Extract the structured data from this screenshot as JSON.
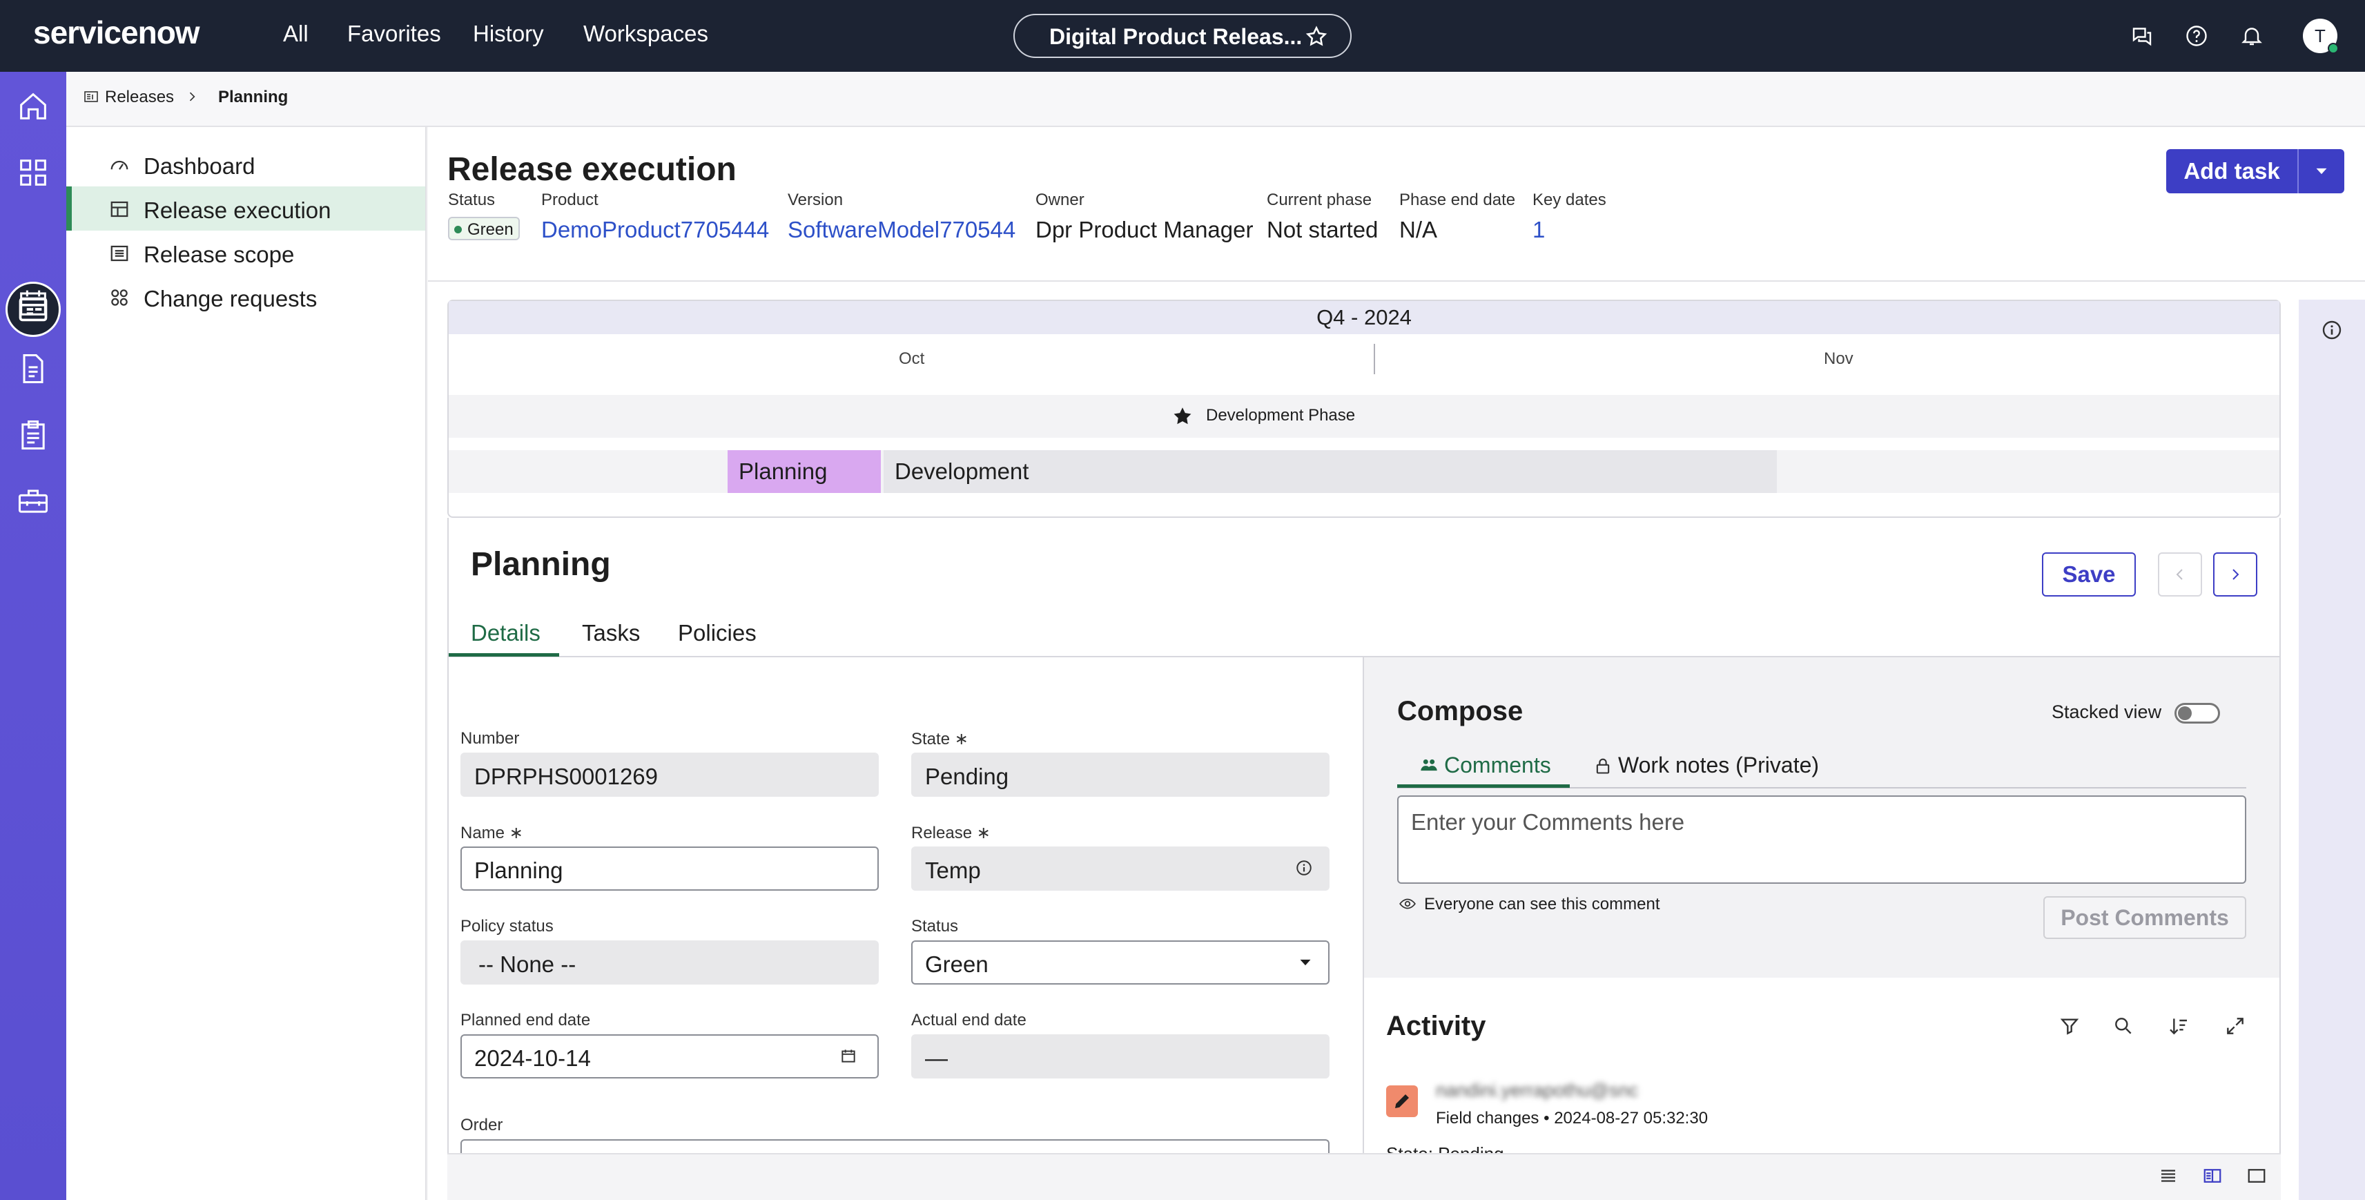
{
  "topbar": {
    "logo": "servicenow",
    "nav": [
      "All",
      "Favorites",
      "History",
      "Workspaces"
    ],
    "workspace_title": "Digital Product Releas...",
    "avatar_initial": "T"
  },
  "breadcrumb": {
    "root": "Releases",
    "current": "Planning"
  },
  "leftnav": {
    "items": [
      {
        "label": "Dashboard"
      },
      {
        "label": "Release execution"
      },
      {
        "label": "Release scope"
      },
      {
        "label": "Change requests"
      }
    ]
  },
  "header": {
    "title": "Release execution",
    "add_task": "Add task",
    "fields": {
      "status_label": "Status",
      "status_value": "Green",
      "product_label": "Product",
      "product_value": "DemoProduct7705444",
      "version_label": "Version",
      "version_value": "SoftwareModel770544",
      "owner_label": "Owner",
      "owner_value": "Dpr Product Manager",
      "phase_label": "Current phase",
      "phase_value": "Not started",
      "phase_end_label": "Phase end date",
      "phase_end_value": "N/A",
      "key_dates_label": "Key dates",
      "key_dates_value": "1"
    }
  },
  "timeline": {
    "quarter": "Q4 - 2024",
    "months": [
      "Oct",
      "Nov"
    ],
    "milestone": "Development Phase",
    "phases": [
      "Planning",
      "Development"
    ]
  },
  "detail": {
    "title": "Planning",
    "save": "Save",
    "tabs": [
      "Details",
      "Tasks",
      "Policies"
    ],
    "form": {
      "number_label": "Number",
      "number_value": "DPRPHS0001269",
      "state_label": "State",
      "state_value": "Pending",
      "name_label": "Name",
      "name_value": "Planning",
      "release_label": "Release",
      "release_value": "Temp",
      "policy_label": "Policy status",
      "policy_value": "-- None --",
      "status_label": "Status",
      "status_value": "Green",
      "planned_label": "Planned end date",
      "planned_value": "2024-10-14",
      "actual_label": "Actual end date",
      "actual_value": "—",
      "order_label": "Order",
      "required_mark": "∗"
    }
  },
  "compose": {
    "title": "Compose",
    "stacked_view": "Stacked view",
    "tab_comments": "Comments",
    "tab_worknotes": "Work notes (Private)",
    "placeholder": "Enter your Comments here",
    "visibility": "Everyone can see this comment",
    "post": "Post Comments"
  },
  "activity": {
    "title": "Activity",
    "entry_user": "nandini.yerrapothu@snc",
    "entry_type": "Field changes",
    "entry_sep": "•",
    "entry_time": "2024-08-27 05:32:30",
    "entry_next": "State: Pending"
  },
  "colors": {
    "topbar": "#1c2333",
    "rail": "#5a4fd1",
    "primary": "#3d3ec5",
    "link": "#2d50c8",
    "green": "#2e8b57",
    "planning_phase": "#d9a8f0",
    "development_phase": "#e6e6ea"
  }
}
